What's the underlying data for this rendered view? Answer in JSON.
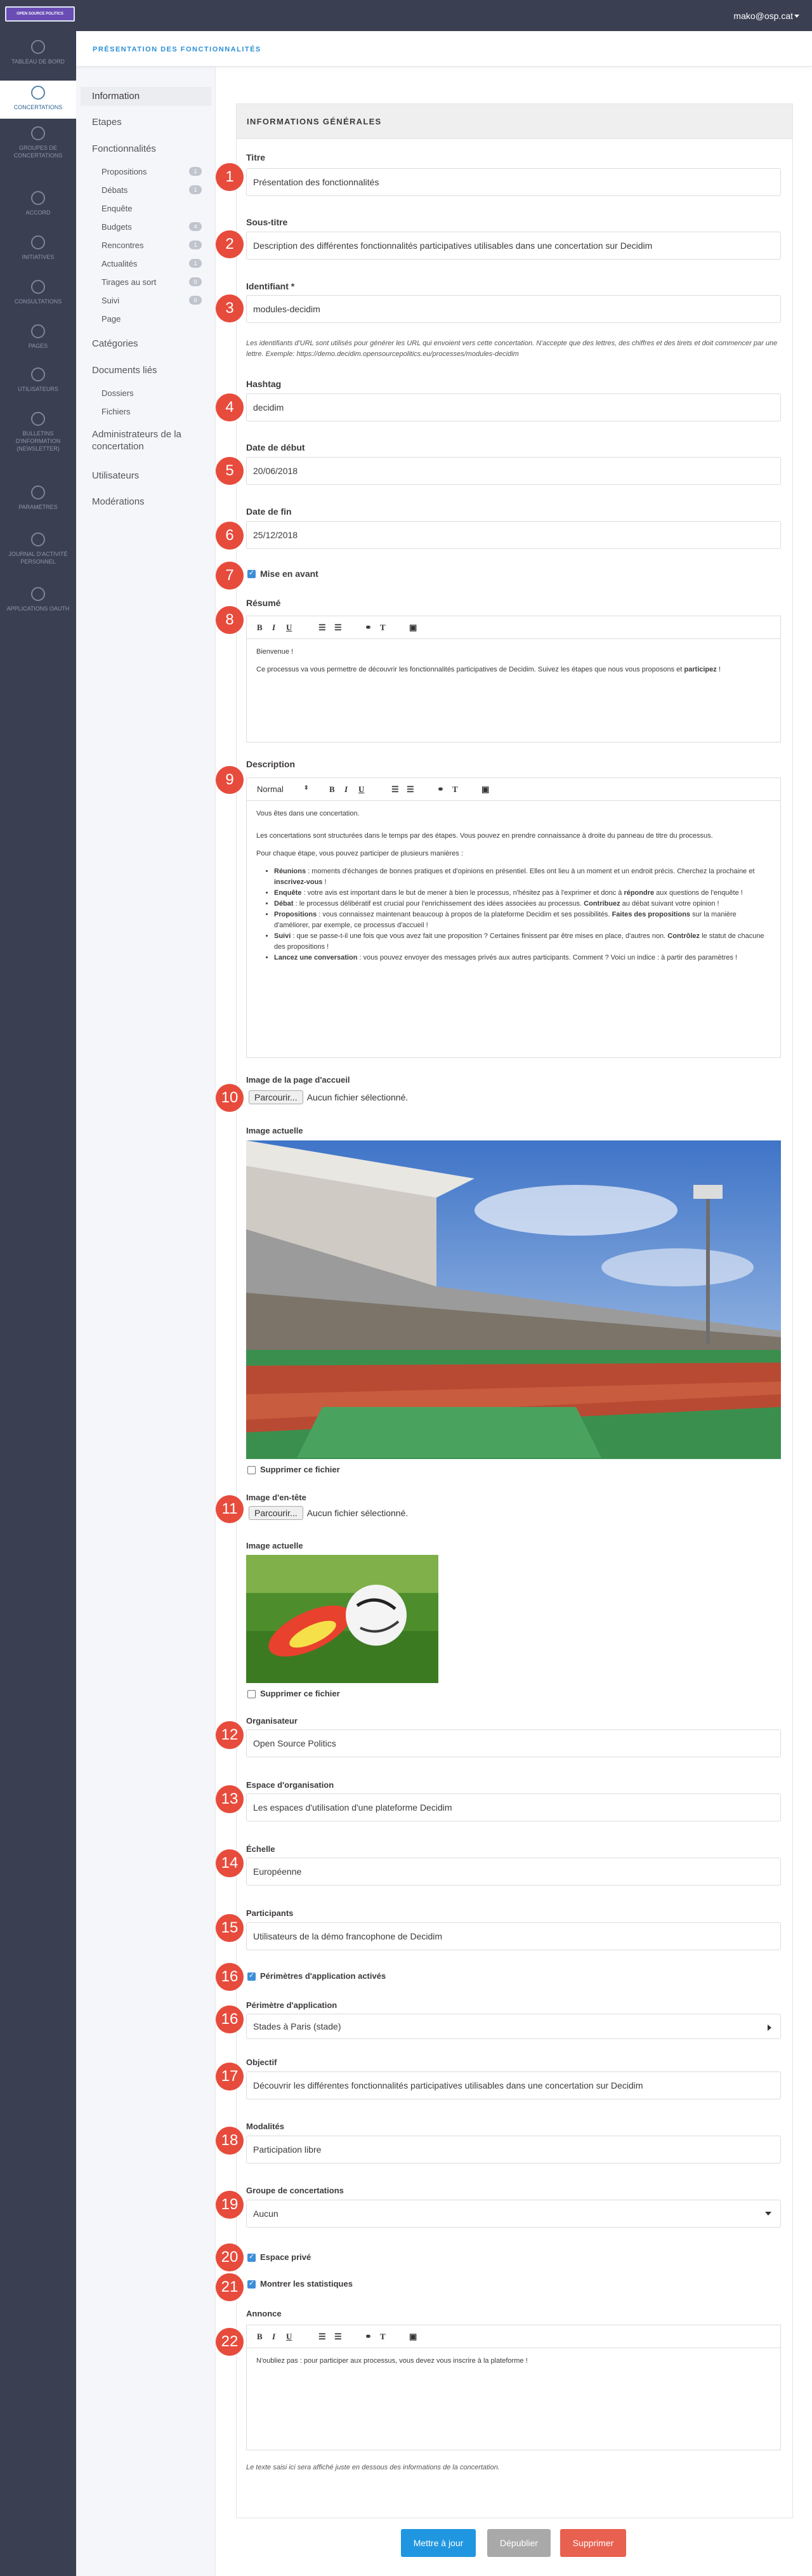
{
  "topbar": {
    "logo_text": "OPEN SOURCE POLITICS",
    "user_email": "mako@osp.cat"
  },
  "sidebar": {
    "items": [
      {
        "label": "Tableau de bord"
      },
      {
        "label": "Concertations"
      },
      {
        "label": "Groupes de concertations"
      },
      {
        "label": "Accord"
      },
      {
        "label": "Initiatives"
      },
      {
        "label": "Consultations"
      },
      {
        "label": "Pages"
      },
      {
        "label": "Utilisateurs"
      },
      {
        "label": "Bulletins d'information (newsletter)"
      },
      {
        "label": "Paramètres"
      },
      {
        "label": "Journal d'activité personnel"
      },
      {
        "label": "Applications OAuth"
      }
    ]
  },
  "section_title": "PRÉSENTATION DES FONCTIONNALITÉS",
  "subnav": {
    "information": "Information",
    "etapes": "Etapes",
    "fonctionnalites": "Fonctionnalités",
    "components": [
      {
        "label": "Propositions",
        "badge": "1"
      },
      {
        "label": "Débats",
        "badge": "1"
      },
      {
        "label": "Enquête",
        "badge": ""
      },
      {
        "label": "Budgets",
        "badge": "4"
      },
      {
        "label": "Rencontres",
        "badge": "1"
      },
      {
        "label": "Actualités",
        "badge": "1"
      },
      {
        "label": "Tirages au sort",
        "badge": "0"
      },
      {
        "label": "Suivi",
        "badge": "0"
      },
      {
        "label": "Page",
        "badge": ""
      }
    ],
    "categories": "Catégories",
    "documents": "Documents liés",
    "dossiers": "Dossiers",
    "fichiers": "Fichiers",
    "administrateurs": "Administrateurs de la concertation",
    "utilisateurs": "Utilisateurs",
    "moderations": "Modérations"
  },
  "form": {
    "card_title": "INFORMATIONS GÉNÉRALES",
    "markers": [
      "1",
      "2",
      "3",
      "4",
      "5",
      "6",
      "7",
      "8",
      "9",
      "10",
      "11",
      "12",
      "13",
      "14",
      "15",
      "16",
      "16",
      "17",
      "18",
      "19",
      "20",
      "21",
      "22"
    ],
    "titre_label": "Titre",
    "titre_value": "Présentation des fonctionnalités",
    "soustitre_label": "Sous-titre",
    "soustitre_value": "Description des différentes fonctionnalités participatives utilisables dans une concertation sur Decidim",
    "identifiant_label": "Identifiant *",
    "identifiant_value": "modules-decidim",
    "identifiant_help": "Les identifiants d'URL sont utilisés pour générer les URL qui envoient vers cette concertation. N'accepte que des lettres, des chiffres et des tirets et doit commencer par une lettre. Exemple: https://demo.decidim.opensourcepolitics.eu/processes/modules-decidim",
    "hashtag_label": "Hashtag",
    "hashtag_value": "decidim",
    "debut_label": "Date de début",
    "debut_value": "20/06/2018",
    "fin_label": "Date de fin",
    "fin_value": "25/12/2018",
    "mise_en_avant": "Mise en avant",
    "resume_label": "Résumé",
    "resume_p1": "Bienvenue !",
    "resume_p2a": "Ce processus va vous permettre de découvrir les fonctionnalités participatives de Decidim. Suivez les étapes que nous vous proposons et ",
    "resume_p2b": "participez",
    "resume_p2c": " !",
    "description_label": "Description",
    "description_format": "Normal",
    "desc_p1": "Vous êtes dans une concertation.",
    "desc_p2": "Les concertations sont structurées dans le temps par des étapes. Vous pouvez en prendre connaissance à droite du panneau de titre du processus.",
    "desc_p3": "Pour chaque étape, vous pouvez participer de plusieurs manières :",
    "desc_items": [
      {
        "b": "Réunions",
        "t": " : moments d'échanges de bonnes pratiques et d'opinions en présentiel. Elles ont lieu à un moment et un endroit précis. Cherchez la prochaine et ",
        "b2": "inscrivez-vous",
        "t2": " !"
      },
      {
        "b": "Enquête",
        "t": " : votre avis est important dans le but de mener à bien le processus, n'hésitez pas à l'exprimer et donc à ",
        "b2": "répondre",
        "t2": " aux questions de l'enquête !"
      },
      {
        "b": "Débat",
        "t": " : le processus délibératif est crucial pour l'enrichissement des idées associées au processus. ",
        "b2": "Contribuez",
        "t2": " au débat suivant votre opinion !"
      },
      {
        "b": "Propositions",
        "t": " : vous connaissez maintenant beaucoup à propos de la plateforme Decidim et ses possibilités. ",
        "b2": "Faites des propositions",
        "t2": " sur la manière d'améliorer, par exemple, ce processus d'accueil !"
      },
      {
        "b": "Suivi",
        "t": " : que se passe-t-il une fois que vous avez fait une proposition ? Certaines finissent par être mises en place, d'autres non. ",
        "b2": "Contrôlez",
        "t2": " le statut de chacune des propositions !"
      },
      {
        "b": "Lancez une conversation",
        "t": " : vous pouvez envoyer des messages privés aux autres participants. Comment ? Voici un indice : à partir des paramètres !",
        "b2": "",
        "t2": ""
      }
    ],
    "image_accueil_label": "Image de la page d'accueil",
    "browse": "Parcourir...",
    "no_file": "Aucun fichier sélectionné.",
    "current_image": "Image actuelle",
    "delete_file": "Supprimer ce fichier",
    "image_entete_label": "Image d'en-tête",
    "organisateur_label": "Organisateur",
    "organisateur_value": "Open Source Politics",
    "espace_label": "Espace d'organisation",
    "espace_value": "Les espaces d'utilisation d'une plateforme Decidim",
    "echelle_label": "Échelle",
    "echelle_value": "Européenne",
    "participants_label": "Participants",
    "participants_value": "Utilisateurs de la démo francophone de Decidim",
    "perimetres_actives": "Périmètres d'application activés",
    "perimetre_label": "Périmètre d'application",
    "perimetre_value": "Stades à Paris (stade)",
    "objectif_label": "Objectif",
    "objectif_value": "Découvrir les différentes fonctionnalités participatives utilisables dans une concertation sur Decidim",
    "modalites_label": "Modalités",
    "modalites_value": "Participation libre",
    "groupe_label": "Groupe de concertations",
    "groupe_value": "Aucun",
    "espace_prive": "Espace privé",
    "statistiques": "Montrer les statistiques",
    "annonce_label": "Annonce",
    "annonce_value": "N'oubliez pas : pour participer aux processus, vous devez vous inscrire à la plateforme !",
    "annonce_help": "Le texte saisi ici sera affiché juste en dessous des informations de la concertation."
  },
  "actions": {
    "update": "Mettre à jour",
    "unpublish": "Dépublier",
    "delete": "Supprimer"
  },
  "colors": {
    "marker": "#e74b3c",
    "primary": "#2196e0",
    "delete": "#e8604f",
    "unpublish": "#a9a9a9"
  }
}
